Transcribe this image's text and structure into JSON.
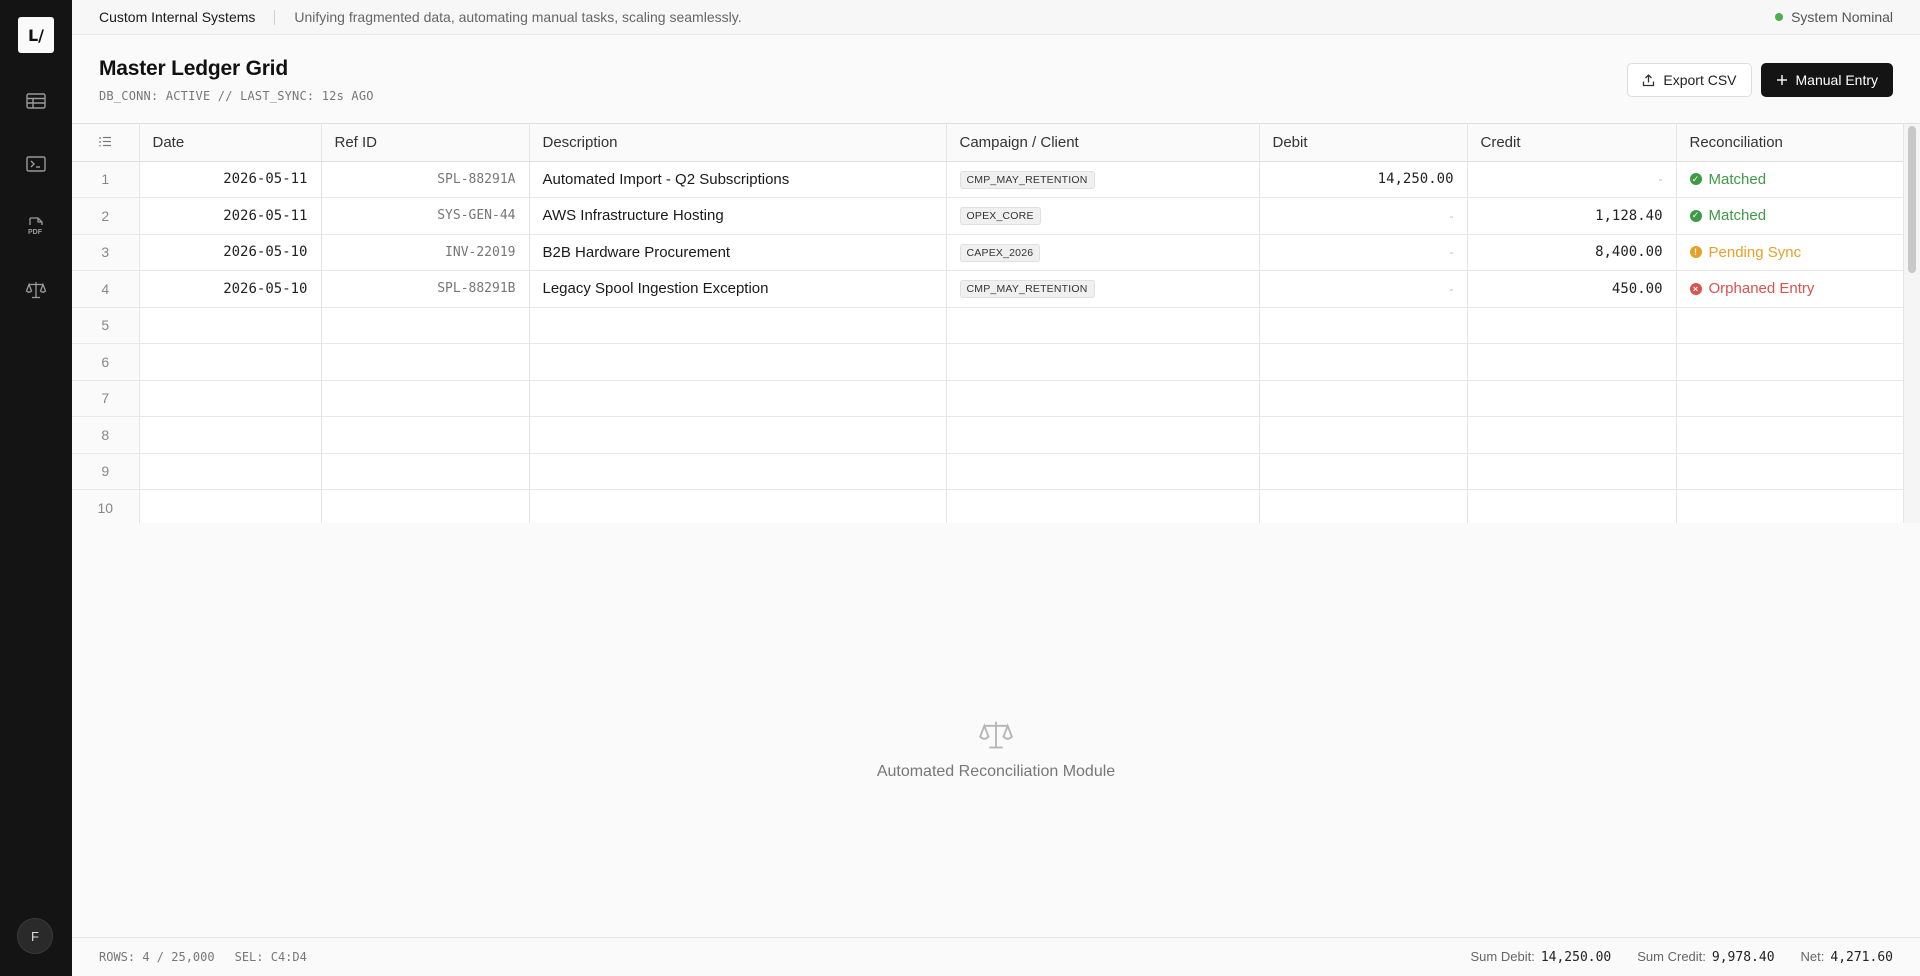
{
  "sidebar": {
    "logo": "L/",
    "items": [
      {
        "icon": "table-icon"
      },
      {
        "icon": "terminal-icon"
      },
      {
        "icon": "pdf-icon",
        "label": "PDF"
      },
      {
        "icon": "scale-icon"
      }
    ],
    "avatar": "F"
  },
  "topbar": {
    "brand": "Custom Internal Systems",
    "tagline": "Unifying fragmented data, automating manual tasks, scaling seamlessly.",
    "status": "System Nominal",
    "status_color": "#4caf50"
  },
  "header": {
    "title": "Master Ledger Grid",
    "subtitle": "DB_CONN: ACTIVE // LAST_SYNC: 12s AGO",
    "export_label": "Export CSV",
    "manual_label": "Manual Entry"
  },
  "grid": {
    "columns": [
      "Date",
      "Ref ID",
      "Description",
      "Campaign / Client",
      "Debit",
      "Credit",
      "Reconciliation"
    ],
    "rows": [
      {
        "n": "1",
        "date": "2026-05-11",
        "ref": "SPL-88291A",
        "desc": "Automated Import - Q2 Subscriptions",
        "tag": "CMP_MAY_RETENTION",
        "debit": "14,250.00",
        "credit": "-",
        "status": "Matched",
        "status_type": "ok"
      },
      {
        "n": "2",
        "date": "2026-05-11",
        "ref": "SYS-GEN-44",
        "desc": "AWS Infrastructure Hosting",
        "tag": "OPEX_CORE",
        "debit": "-",
        "credit": "1,128.40",
        "status": "Matched",
        "status_type": "ok"
      },
      {
        "n": "3",
        "date": "2026-05-10",
        "ref": "INV-22019",
        "desc": "B2B Hardware Procurement",
        "tag": "CAPEX_2026",
        "debit": "-",
        "credit": "8,400.00",
        "status": "Pending Sync",
        "status_type": "warn"
      },
      {
        "n": "4",
        "date": "2026-05-10",
        "ref": "SPL-88291B",
        "desc": "Legacy Spool Ingestion Exception",
        "tag": "CMP_MAY_RETENTION",
        "debit": "-",
        "credit": "450.00",
        "status": "Orphaned Entry",
        "status_type": "err"
      }
    ],
    "empty_rows": [
      "5",
      "6",
      "7",
      "8",
      "9",
      "10"
    ],
    "status_colors": {
      "ok": "#3f9a45",
      "warn": "#e6a028",
      "err": "#d9534f"
    }
  },
  "module": {
    "label": "Automated Reconciliation Module"
  },
  "footer": {
    "rows": "ROWS: 4 / 25,000",
    "sel": "SEL: C4:D4",
    "sum_debit_label": "Sum Debit:",
    "sum_debit": "14,250.00",
    "sum_credit_label": "Sum Credit:",
    "sum_credit": "9,978.40",
    "net_label": "Net:",
    "net": "4,271.60"
  }
}
